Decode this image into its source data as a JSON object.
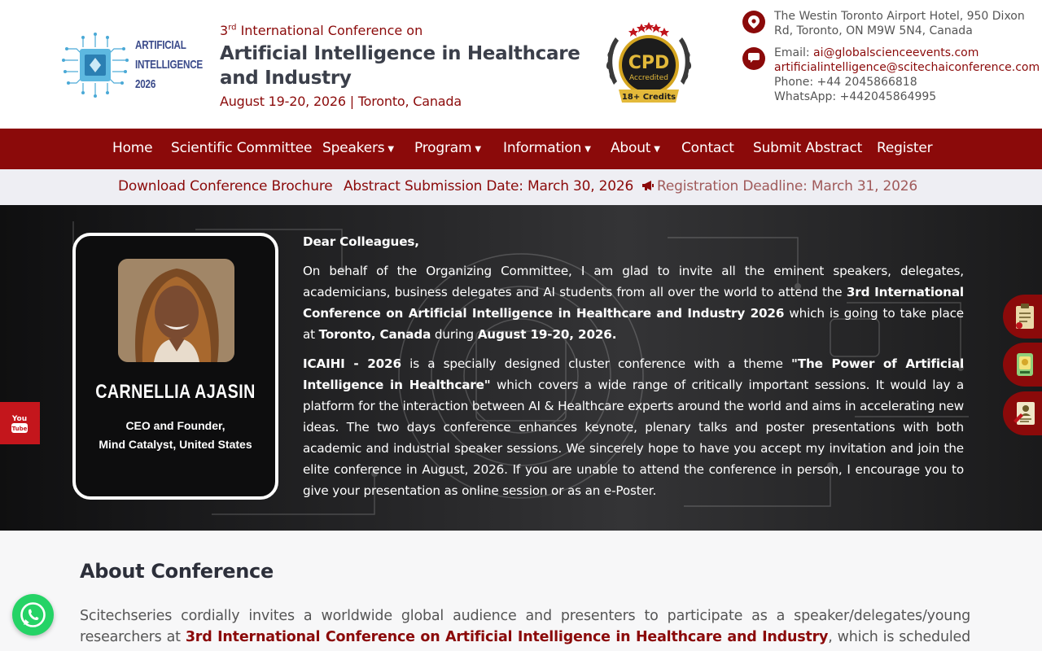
{
  "logo": {
    "line1": "ARTIFICIAL",
    "line2": "INTELLIGENCE",
    "line3": "2026"
  },
  "header": {
    "edition_prefix": "3",
    "edition_sup": "rd",
    "edition_suffix": " International Conference on",
    "conference_name": "Artificial Intelligence in Healthcare and Industry",
    "date_location": "August 19-20, 2026 | Toronto, Canada"
  },
  "badge": {
    "title": "CPD",
    "subtitle": "Accredited",
    "credits": "18+ Credits"
  },
  "contact": {
    "address": "The Westin Toronto Airport Hotel, 950 Dixon Rd, Toronto, ON M9W 5N4, Canada",
    "email_label": "Email:",
    "email1": "ai@globalscienceevents.com",
    "email2": "artificialintelligence@scitechaiconference.com",
    "phone": "Phone: +44 2045866818",
    "whatsapp": "WhatsApp: +442045864995"
  },
  "nav": {
    "home": "Home",
    "committee": "Scientific Committee",
    "speakers": "Speakers",
    "program": "Program",
    "information": "Information",
    "about": "About",
    "contact": "Contact",
    "submit": "Submit Abstract",
    "register": "Register"
  },
  "subbar": {
    "brochure": "Download Conference Brochure",
    "abstract_date": "Abstract Submission Date: March 30, 2026",
    "registration_deadline": "Registration Deadline: March 31, 2026"
  },
  "speaker": {
    "name": "CARNELLIA AJASIN",
    "role_line1": "CEO and Founder,",
    "role_line2": "Mind Catalyst, United States"
  },
  "welcome": {
    "salutation": "Dear Colleagues,",
    "p1_a": "On behalf of the Organizing Committee, I am glad to invite all the eminent speakers, delegates, academicians, business delegates and AI students from all over the world to attend the ",
    "p1_b": "3rd International Conference on Artificial Intelligence in Healthcare and Industry 2026",
    "p1_c": " which is going to take place at ",
    "p1_d": "Toronto, Canada",
    "p1_e": " during ",
    "p1_f": "August 19-20, 2026.",
    "p2_a": "ICAIHI - 2026",
    "p2_b": " is a specially designed cluster conference with a theme ",
    "p2_c": "\"The Power of Artificial Intelligence in Healthcare\"",
    "p2_d": " which covers a wide range of critically important sessions. It would lay a platform for the interaction between AI & Healthcare experts around the world and aims in accelerating new ideas. The two days conference enhances keynote, plenary talks and poster presentations with both academic and industrial speaker sessions. We sincerely hope to have you accept my invitation and join the elite conference in August, 2026. If you are unable to attend the conference in person, I encourage you to give your presentation as online session or as an e-Poster."
  },
  "about": {
    "title": "About Conference",
    "text_a": "Scitechseries cordially invites a worldwide global audience and presenters to participate as a speaker/delegates/young researchers at ",
    "text_b": "3rd International Conference on Artificial Intelligence in Healthcare and Industry",
    "text_c": ", which is scheduled to be held"
  },
  "icons": {
    "location": "map-pin-icon",
    "chat": "chat-bubble-icon",
    "megaphone": "megaphone-icon",
    "youtube": "youtube-icon",
    "whatsapp": "whatsapp-icon"
  },
  "colors": {
    "brand": "#8b0a0a",
    "nav_bg": "#8b0a0a",
    "subbar_bg": "#eeeef3",
    "whatsapp": "#25d366",
    "youtube": "#c4161c"
  }
}
